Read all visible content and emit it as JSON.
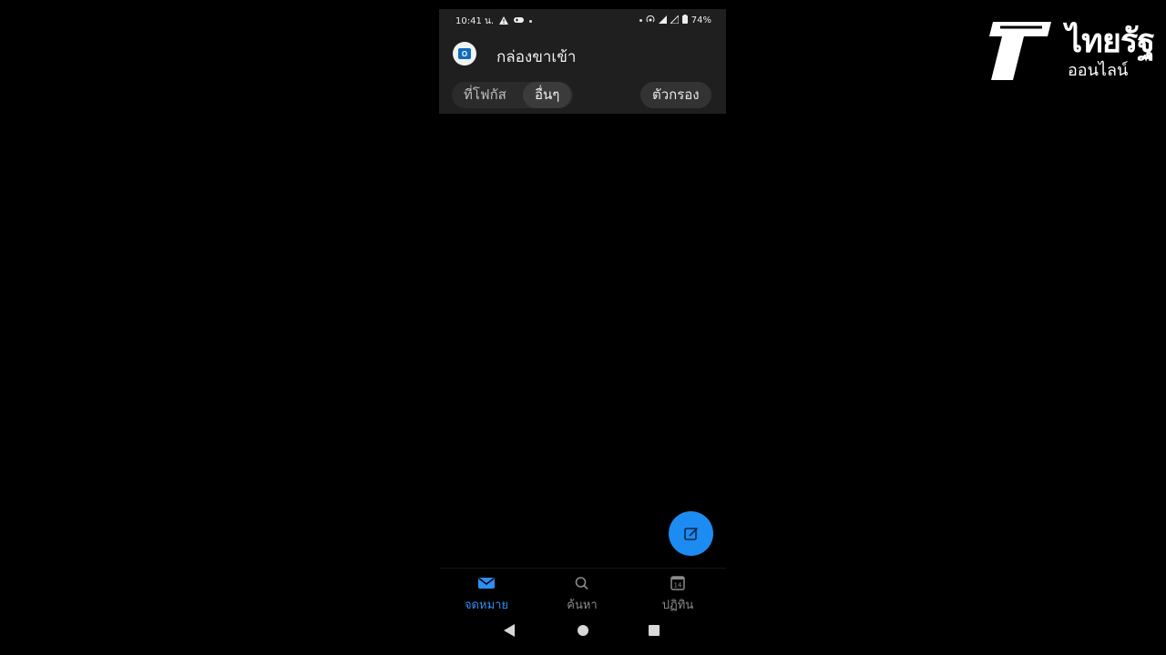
{
  "status_bar": {
    "time": "10:41 น.",
    "battery": "74%",
    "icons": [
      "warning-icon",
      "game-controller-icon",
      "dot-icon",
      "hotspot-icon",
      "signal-icon",
      "signal-icon",
      "battery-icon"
    ]
  },
  "header": {
    "title": "กล่องขาเข้า",
    "avatar_icon": "outlook-icon"
  },
  "tabs": {
    "focused": "ที่โฟกัส",
    "other": "อื่นๆ",
    "selected": "อื่นๆ"
  },
  "filter": {
    "label": "ตัวกรอง"
  },
  "compose": {
    "icon": "compose-icon",
    "color": "#1c8cf2"
  },
  "bottom_nav": {
    "items": [
      {
        "label": "จดหมาย",
        "icon": "mail-icon",
        "active": true
      },
      {
        "label": "ค้นหา",
        "icon": "search-icon",
        "active": false
      },
      {
        "label": "ปฏิทิน",
        "icon": "calendar-icon",
        "active": false,
        "day": "14"
      }
    ]
  },
  "system_nav": [
    "back-icon",
    "home-icon",
    "recents-icon"
  ],
  "watermark": {
    "name": "ไทยรัฐ",
    "sub": "ออนไลน์"
  },
  "colors": {
    "accent": "#2e8ef0",
    "background": "#000000",
    "topbar": "#1f1f1f"
  }
}
